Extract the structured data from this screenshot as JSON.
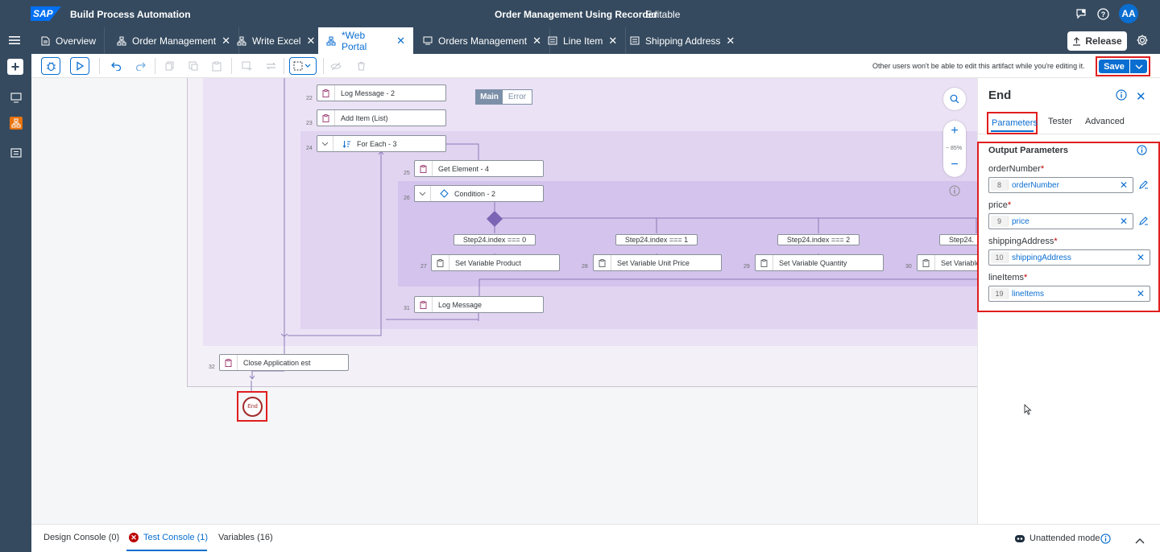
{
  "shell": {
    "product": "Build Process Automation",
    "title": "Order Management Using Recorder",
    "status": "Editable",
    "avatar": "AA",
    "logo": "SAP"
  },
  "tabs": [
    {
      "label": "Overview",
      "icon": "document-icon",
      "closable": false
    },
    {
      "label": "Order Management",
      "icon": "process-icon",
      "closable": true
    },
    {
      "label": "Write Excel",
      "icon": "process-icon",
      "closable": true
    },
    {
      "label": "*Web Portal",
      "icon": "process-icon",
      "closable": true,
      "active": true
    },
    {
      "label": "Orders Management",
      "icon": "monitor-icon",
      "closable": true
    },
    {
      "label": "Line Item",
      "icon": "list-icon",
      "closable": true
    },
    {
      "label": "Shipping Address",
      "icon": "list-icon",
      "closable": true
    }
  ],
  "release_label": "Release",
  "toolbar": {
    "message": "Other users won't be able to edit this artifact while you're editing it.",
    "save_label": "Save"
  },
  "canvas": {
    "main_label": "Main",
    "error_label": "Error",
    "zoom_level": "~ 85%",
    "end_label": "End",
    "nodes": [
      {
        "num": "22",
        "label": "Log Message - 2"
      },
      {
        "num": "23",
        "label": "Add Item (List)"
      },
      {
        "num": "24",
        "label": "For Each - 3"
      },
      {
        "num": "25",
        "label": "Get Element - 4"
      },
      {
        "num": "26",
        "label": "Condition - 2"
      },
      {
        "num": "27",
        "label": "Set Variable Product"
      },
      {
        "num": "28",
        "label": "Set Variable Unit Price"
      },
      {
        "num": "29",
        "label": "Set Variable Quantity"
      },
      {
        "num": "30",
        "label": "Set Variable"
      },
      {
        "num": "31",
        "label": "Log Message"
      },
      {
        "num": "32",
        "label": "Close Application est"
      }
    ],
    "conditions": [
      "Step24.index === 0",
      "Step24.index === 1",
      "Step24.index === 2",
      "Step24."
    ]
  },
  "panel": {
    "title": "End",
    "tabs": [
      "Parameters",
      "Tester",
      "Advanced"
    ],
    "section_title": "Output Parameters",
    "params": [
      {
        "label": "orderNumber",
        "num": "8",
        "value": "orderNumber"
      },
      {
        "label": "price",
        "num": "9",
        "value": "price"
      },
      {
        "label": "shippingAddress",
        "num": "10",
        "value": "shippingAddress"
      },
      {
        "label": "lineItems",
        "num": "19",
        "value": "lineItems"
      }
    ]
  },
  "bottom": {
    "design_console": "Design Console (0)",
    "test_console": "Test Console (1)",
    "variables": "Variables (16)",
    "mode": "Unattended mode"
  },
  "colors": {
    "shell": "#354a5f",
    "accent": "#0a6ed1",
    "highlight": "#e01e1e",
    "zone_outer": "#ebe2f5",
    "zone_inner": "#d9c8ee"
  }
}
